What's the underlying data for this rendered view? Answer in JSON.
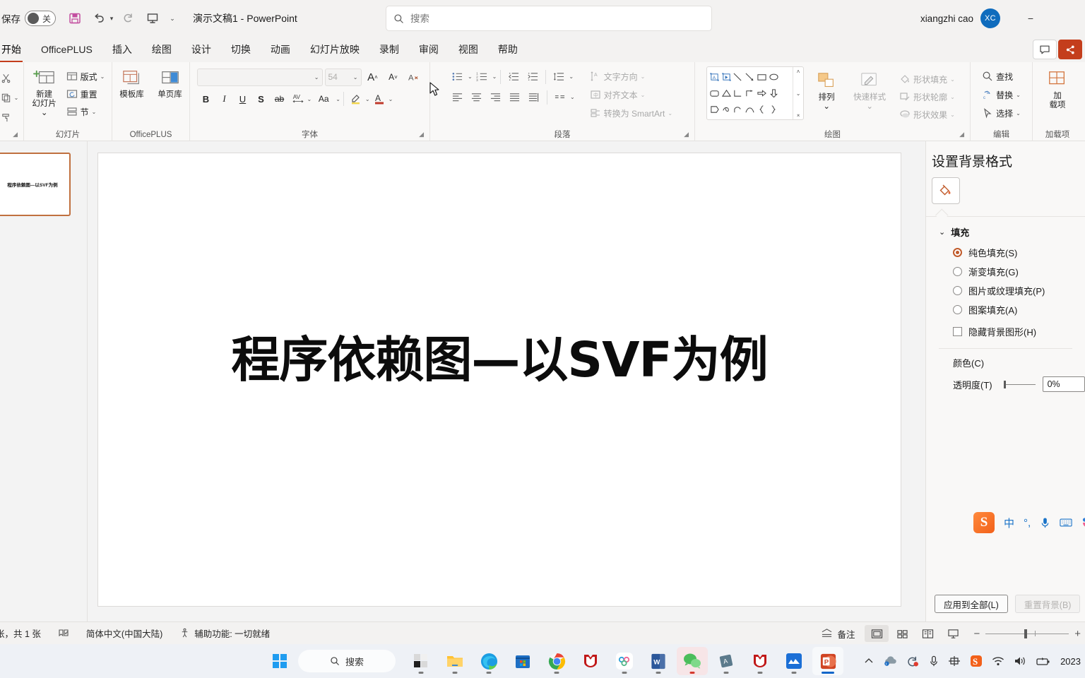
{
  "titlebar": {
    "autosave_label": "保存",
    "autosave_state": "关",
    "save_icon": "floppy-disk-icon",
    "undo_icon": "undo-icon",
    "redo_icon": "redo-icon",
    "present_icon": "start-presentation-icon",
    "more_icon": "chevron-down-icon",
    "document_title": "演示文稿1  -  PowerPoint",
    "search_placeholder": "搜索",
    "search_value": "",
    "search_icon": "search-icon",
    "user_name": "xiangzhi cao",
    "user_initials": "XC",
    "minimize": "−"
  },
  "ribbon_tabs": {
    "items": [
      {
        "label": "开始",
        "active": true
      },
      {
        "label": "OfficePLUS",
        "active": false
      },
      {
        "label": "插入",
        "active": false
      },
      {
        "label": "绘图",
        "active": false
      },
      {
        "label": "设计",
        "active": false
      },
      {
        "label": "切换",
        "active": false
      },
      {
        "label": "动画",
        "active": false
      },
      {
        "label": "幻灯片放映",
        "active": false
      },
      {
        "label": "录制",
        "active": false
      },
      {
        "label": "审阅",
        "active": false
      },
      {
        "label": "视图",
        "active": false
      },
      {
        "label": "帮助",
        "active": false
      }
    ],
    "comment_button": "批注",
    "share_button": "共享"
  },
  "ribbon": {
    "groups": [
      {
        "name": "剪贴板",
        "label": ""
      },
      {
        "name": "幻灯片",
        "label": "幻灯片"
      },
      {
        "name": "OfficePLUS",
        "label": "OfficePLUS"
      },
      {
        "name": "字体",
        "label": "字体"
      },
      {
        "name": "段落",
        "label": "段落"
      },
      {
        "name": "绘图",
        "label": "绘图"
      },
      {
        "name": "编辑",
        "label": "编辑"
      },
      {
        "name": "加载项",
        "label": "加载项"
      }
    ],
    "slides": {
      "new_slide": "新建\n幻灯片",
      "new_slide_line1": "新建",
      "new_slide_line2": "幻灯片",
      "layout": "版式",
      "reset": "重置",
      "section": "节",
      "group_label": "幻灯片"
    },
    "officeplus": {
      "template_library": "模板库",
      "page_library": "单页库",
      "group_label": "OfficePLUS"
    },
    "font": {
      "font_name": "",
      "font_size": "54",
      "bold": "B",
      "italic": "I",
      "underline": "U",
      "shadow": "S",
      "strikethrough": "ab",
      "char_spacing": "AV",
      "change_case": "Aa",
      "increase_size": "A",
      "decrease_size": "A",
      "clear_format": "A",
      "text_highlight": "highlight-icon",
      "font_color": "A",
      "group_label": "字体"
    },
    "paragraph": {
      "bullets": "bullets-icon",
      "numbering": "numbering-icon",
      "decrease_indent": "decrease-indent-icon",
      "increase_indent": "increase-indent-icon",
      "line_spacing": "line-spacing-icon",
      "align_left": "align-left-icon",
      "align_center": "align-center-icon",
      "align_right": "align-right-icon",
      "justify": "justify-icon",
      "columns": "columns-icon",
      "text_direction": "文字方向",
      "align_text": "对齐文本",
      "convert_smartart": "转换为 SmartArt",
      "group_label": "段落"
    },
    "drawing": {
      "arrange": "排列",
      "quick_styles": "快速样式",
      "shape_fill": "形状填充",
      "shape_outline": "形状轮廓",
      "shape_effects": "形状效果",
      "group_label": "绘图"
    },
    "editing": {
      "find": "查找",
      "replace": "替换",
      "select": "选择",
      "group_label": "编辑"
    },
    "addins": {
      "addin_line1": "加",
      "addin_line2": "载项",
      "group_label": "加载项"
    }
  },
  "thumbnails": {
    "slide1_text": "程序依赖图—以SVF为例"
  },
  "slide": {
    "title": "程序依赖图—以SVF为例"
  },
  "bgpanel": {
    "title": "设置背景格式",
    "fill_icon": "paint-bucket-icon",
    "section_fill": "填充",
    "options": [
      {
        "label": "纯色填充(S)",
        "checked": true
      },
      {
        "label": "渐变填充(G)",
        "checked": false
      },
      {
        "label": "图片或纹理填充(P)",
        "checked": false
      },
      {
        "label": "图案填充(A)",
        "checked": false
      }
    ],
    "hide_bg_graphics": "隐藏背景图形(H)",
    "hide_bg_checked": false,
    "color_label": "颜色(C)",
    "transparency_label": "透明度(T)",
    "transparency_value": "0%",
    "apply_all_button": "应用到全部(L)",
    "reset_bg_button": "重置背景(B)",
    "accent_color": "#c05a2a"
  },
  "ime": {
    "logo": "S",
    "mode_label": "中",
    "punctuation": "°,",
    "mic_icon": "microphone-icon",
    "keyboard_icon": "keyboard-icon",
    "skin_icon": "skin-icon"
  },
  "statusbar": {
    "slide_count": "张，共 1 张",
    "spellcheck_icon": "spellcheck-icon",
    "language": "简体中文(中国大陆)",
    "accessibility_icon": "accessibility-icon",
    "accessibility": "辅助功能: 一切就绪",
    "notes_button": "备注",
    "notes_icon": "notes-icon",
    "view_normal": "normal-view-icon",
    "view_sorter": "slide-sorter-icon",
    "view_reading": "reading-view-icon",
    "view_slideshow": "slideshow-icon",
    "zoom_out": "−",
    "zoom_in": "+"
  },
  "taskbar": {
    "start_icon": "windows-start-icon",
    "search_label": "搜索",
    "search_icon": "search-icon",
    "apps": [
      {
        "name": "task-view-icon",
        "running": true
      },
      {
        "name": "file-explorer-icon",
        "running": true
      },
      {
        "name": "edge-icon",
        "running": true
      },
      {
        "name": "microsoft-store-icon",
        "running": false
      },
      {
        "name": "chrome-icon",
        "running": true
      },
      {
        "name": "mcafee-icon",
        "running": false
      },
      {
        "name": "baidu-netdisk-icon",
        "running": true
      },
      {
        "name": "word-icon",
        "running": true
      },
      {
        "name": "wechat-icon",
        "running": true
      },
      {
        "name": "ai-chip-icon",
        "running": true
      },
      {
        "name": "mcafee-2-icon",
        "running": true
      },
      {
        "name": "mountain-app-icon",
        "running": true
      },
      {
        "name": "powerpoint-icon",
        "running": true
      }
    ],
    "tray": {
      "chevron_up": "chevron-up-icon",
      "onedrive_icon": "onedrive-icon",
      "sync_icon": "sync-recording-icon",
      "mic_icon": "microphone-icon",
      "ime_icon": "ime-chinese-icon",
      "sogou_icon": "sogou-icon",
      "wifi_icon": "wifi-icon",
      "volume_icon": "volume-icon",
      "battery_icon": "battery-icon",
      "clock": "2023"
    }
  }
}
